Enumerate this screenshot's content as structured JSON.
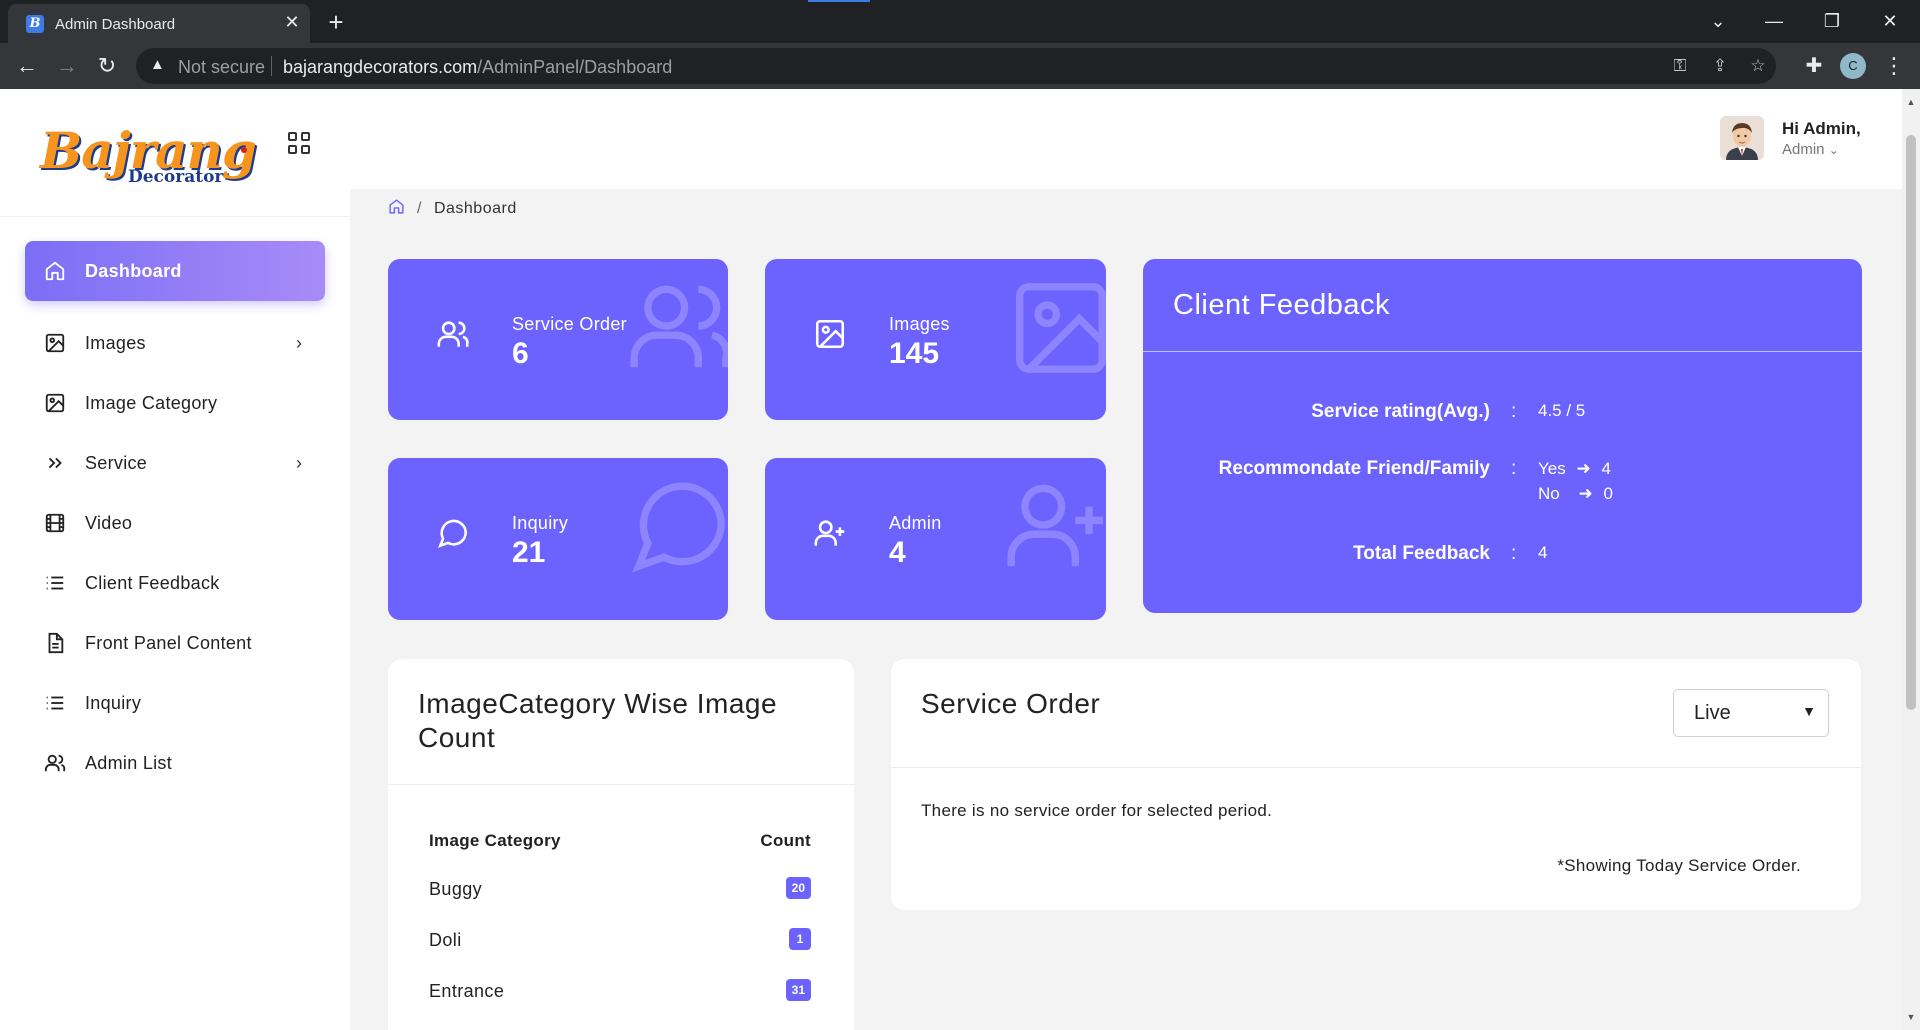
{
  "browser": {
    "tab_title": "Admin Dashboard",
    "favicon_letter": "B",
    "security_label": "Not secure",
    "url_host": "bajarangdecorators.com",
    "url_path": "/AdminPanel/Dashboard",
    "profile_initial": "C"
  },
  "brand": {
    "name": "Bajrang",
    "tagline": "Decorator"
  },
  "sidebar": {
    "items": [
      {
        "label": "Dashboard",
        "icon": "home-icon",
        "active": true
      },
      {
        "label": "Images",
        "icon": "image-icon",
        "has_submenu": true
      },
      {
        "label": "Image Category",
        "icon": "image-icon"
      },
      {
        "label": "Service",
        "icon": "double-chevron-icon",
        "has_submenu": true
      },
      {
        "label": "Video",
        "icon": "film-icon"
      },
      {
        "label": "Client Feedback",
        "icon": "list-icon"
      },
      {
        "label": "Front Panel Content",
        "icon": "document-icon"
      },
      {
        "label": "Inquiry",
        "icon": "list-icon"
      },
      {
        "label": "Admin List",
        "icon": "users-icon"
      }
    ]
  },
  "header": {
    "greeting": "Hi Admin,",
    "role": "Admin"
  },
  "breadcrumb": {
    "current": "Dashboard"
  },
  "stats": [
    {
      "label": "Service Order",
      "value": "6",
      "icon": "users-icon"
    },
    {
      "label": "Images",
      "value": "145",
      "icon": "image-icon"
    },
    {
      "label": "Inquiry",
      "value": "21",
      "icon": "chat-bubble-icon"
    },
    {
      "label": "Admin",
      "value": "4",
      "icon": "add-user-icon"
    }
  ],
  "client_feedback": {
    "title": "Client Feedback",
    "rating_label": "Service rating(Avg.)",
    "rating_value": "4.5 / 5",
    "recommend_label": "Recommondate Friend/Family",
    "yes_label": "Yes",
    "yes_count": "4",
    "no_label": "No",
    "no_count": "0",
    "total_label": "Total Feedback",
    "total_value": "4"
  },
  "category_panel": {
    "title": "ImageCategory Wise Image Count",
    "col_category": "Image Category",
    "col_count": "Count",
    "rows": [
      {
        "name": "Buggy",
        "count": "20"
      },
      {
        "name": "Doli",
        "count": "1"
      },
      {
        "name": "Entrance",
        "count": "31"
      }
    ]
  },
  "service_order_panel": {
    "title": "Service Order",
    "filter_selected": "Live",
    "empty_message": "There is no service order for selected period.",
    "note": "*Showing Today Service Order."
  },
  "colors": {
    "accent": "#6c63ff",
    "active_gradient_start": "#7b6ef6",
    "active_gradient_end": "#a88bf7"
  }
}
